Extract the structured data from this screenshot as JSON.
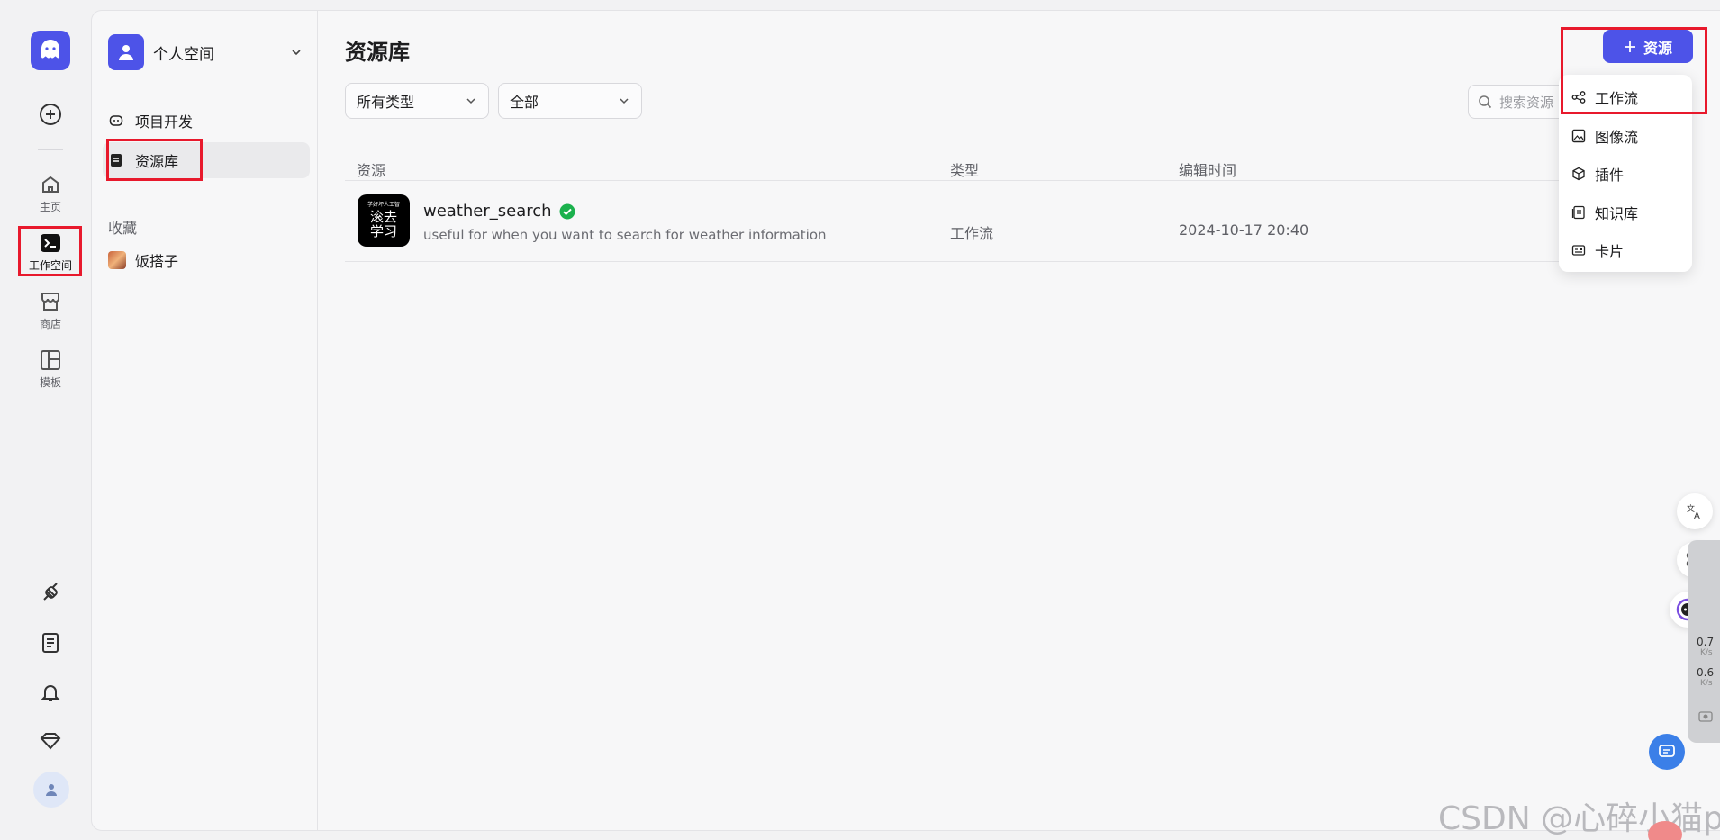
{
  "rail": {
    "items": [
      {
        "label": "主页"
      },
      {
        "label": "工作空间"
      },
      {
        "label": "商店"
      },
      {
        "label": "模板"
      }
    ]
  },
  "sidebar": {
    "space_name": "个人空间",
    "nav": [
      {
        "label": "项目开发"
      },
      {
        "label": "资源库"
      }
    ],
    "favorites_title": "收藏",
    "favorites": [
      {
        "label": "饭搭子"
      }
    ]
  },
  "main": {
    "title": "资源库",
    "filters": {
      "type": "所有类型",
      "scope": "全部"
    },
    "search_placeholder": "搜索资源",
    "add_button": "资源",
    "columns": {
      "resource": "资源",
      "type": "类型",
      "edited": "编辑时间"
    },
    "rows": [
      {
        "thumb_tiny": "学好坏人工智",
        "thumb_line1": "滚去",
        "thumb_line2": "学习",
        "name": "weather_search",
        "desc": "useful for when you want to search for weather information",
        "type": "工作流",
        "edited": "2024-10-17 20:40"
      }
    ]
  },
  "add_menu": {
    "items": [
      {
        "label": "工作流"
      },
      {
        "label": "图像流"
      },
      {
        "label": "插件"
      },
      {
        "label": "知识库"
      },
      {
        "label": "卡片"
      }
    ]
  },
  "netspeed": {
    "up": "0.7",
    "up_unit": "K/s",
    "down": "0.6",
    "down_unit": "K/s"
  },
  "watermark": "CSDN @心碎小猫p",
  "colors": {
    "brand": "#4d53e8",
    "highlight": "#e8192c",
    "verified": "#1bb14d"
  }
}
